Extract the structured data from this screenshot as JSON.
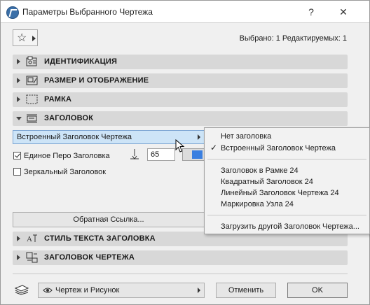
{
  "window": {
    "title": "Параметры Выбранного Чертежа",
    "help_label": "?",
    "close_label": "✕"
  },
  "header": {
    "favorites_icon": "star-icon",
    "selection_info": "Выбрано: 1 Редактируемых: 1"
  },
  "panels": [
    {
      "label": "ИДЕНТИФИКАЦИЯ",
      "icon": "id-card-icon",
      "expanded": false
    },
    {
      "label": "РАЗМЕР И ОТОБРАЖЕНИЕ",
      "icon": "size-display-icon",
      "expanded": false
    },
    {
      "label": "РАМКА",
      "icon": "frame-icon",
      "expanded": false
    },
    {
      "label": "ЗАГОЛОВОК",
      "icon": "title-icon",
      "expanded": true
    }
  ],
  "title_section": {
    "dropdown_value": "Встроенный Заголовок Чертежа",
    "uniform_pen_label": "Единое Перо Заголовка",
    "uniform_pen_checked": true,
    "pen_value": "65",
    "pen_color": "#3a7fe0",
    "mirror_label": "Зеркальный Заголовок",
    "mirror_checked": false,
    "reference_button": "Обратная Ссылка..."
  },
  "lower_panels": [
    {
      "label": "СТИЛЬ ТЕКСТА ЗАГОЛОВКА",
      "icon": "text-style-icon",
      "expanded": false
    },
    {
      "label": "ЗАГОЛОВОК ЧЕРТЕЖА",
      "icon": "drawing-title-icon",
      "expanded": false
    }
  ],
  "menu": {
    "group1": [
      {
        "label": "Нет заголовка",
        "checked": false
      },
      {
        "label": "Встроенный Заголовок Чертежа",
        "checked": true
      }
    ],
    "group2": [
      {
        "label": "Заголовок в Рамке 24"
      },
      {
        "label": "Квадратный Заголовок 24"
      },
      {
        "label": "Линейный Заголовок Чертежа 24"
      },
      {
        "label": "Маркировка Узла 24"
      }
    ],
    "group3": [
      {
        "label": "Загрузить другой Заголовок Чертежа..."
      }
    ]
  },
  "footer": {
    "layout_icon": "layer-stack-icon",
    "view_label": "Чертеж и Рисунок",
    "cancel_label": "Отменить",
    "ok_label": "OK"
  },
  "colors": {
    "panel_bg": "#d8d8d8",
    "dropdown_highlight": "#cde4f7",
    "pen_swatch": "#3a7fe0"
  }
}
